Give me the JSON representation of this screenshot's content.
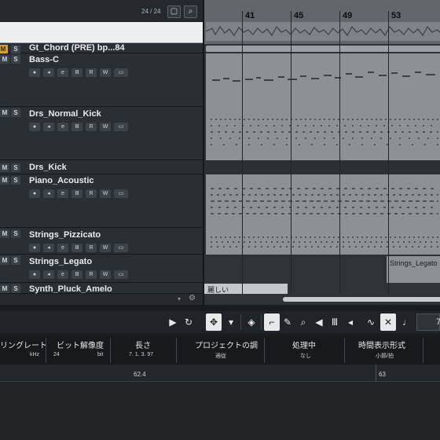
{
  "tracklist": {
    "count": "24 / 24",
    "tracks": [
      {
        "name": "Gt_Chord (PRE) bp...84",
        "mute": "M",
        "solo": "S"
      },
      {
        "name": "Bass-C",
        "mute": "M",
        "solo": "S"
      },
      {
        "name": "Drs_Normal_Kick",
        "mute": "M",
        "solo": "S"
      },
      {
        "name": "Drs_Kick",
        "mute": "M",
        "solo": "S"
      },
      {
        "name": "Piano_Acoustic",
        "mute": "M",
        "solo": "S"
      },
      {
        "name": "Strings_Pizzicato",
        "mute": "M",
        "solo": "S"
      },
      {
        "name": "Strings_Legato",
        "mute": "M",
        "solo": "S"
      },
      {
        "name": "Synth_Pluck_Amelo",
        "mute": "M",
        "solo": "S"
      }
    ],
    "controls": [
      "●",
      "◂",
      "e",
      "Ⅲ",
      "R",
      "W",
      "▭"
    ]
  },
  "ruler": {
    "bars": [
      "41",
      "45",
      "49",
      "53"
    ]
  },
  "parts": {
    "strings_legato": "Strings_Legato",
    "synth": "麗しい"
  },
  "toolbar": {
    "field_value": "7"
  },
  "infoline": {
    "columns": [
      {
        "header": "リングレート",
        "value": "kHz"
      },
      {
        "header": "ビット解像度",
        "value": "24",
        "unit": "bit"
      },
      {
        "header": "長さ",
        "value": "7. 1. 3. 97"
      },
      {
        "header": "プロジェクトの調",
        "value": "適従"
      },
      {
        "header": "処理中",
        "value": "なし"
      },
      {
        "header": "時間表示形式",
        "value": "小節/拍"
      }
    ]
  },
  "lower_ruler": {
    "labels": [
      "62.4",
      "63"
    ]
  }
}
